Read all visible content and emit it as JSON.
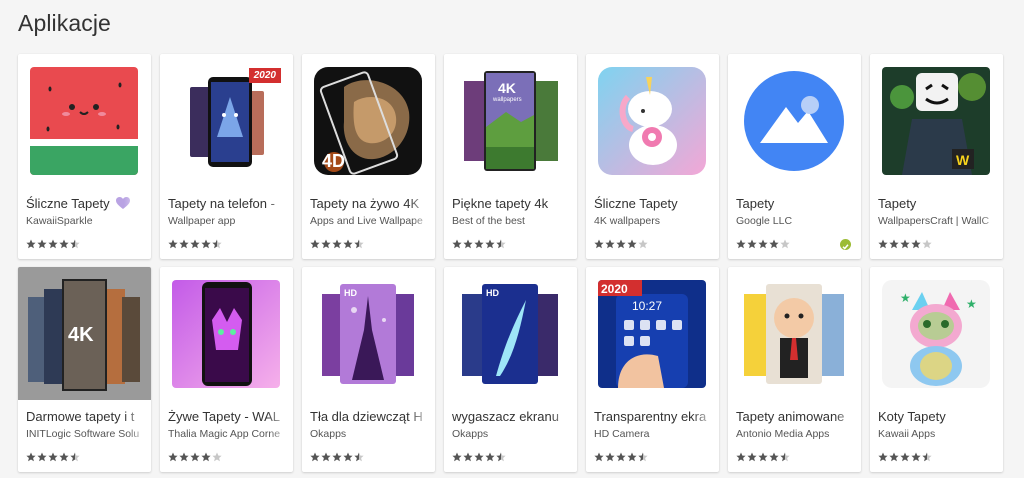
{
  "section": {
    "title": "Aplikacje"
  },
  "row1": [
    {
      "title": "Śliczne Tapety",
      "developer": "KawaiiSparkle",
      "rating": 4.5,
      "icon": "watermelon-icon",
      "heart": true
    },
    {
      "title": "Tapety na telefon - ",
      "developer": "Wallpaper app",
      "rating": 4.5,
      "icon": "wolf-phones-icon",
      "ribbon": "2020"
    },
    {
      "title": "Tapety na żywo 4K",
      "developer": "Apps and Live Wallpape",
      "rating": 4.5,
      "icon": "lion-4d-icon",
      "tag": "4D"
    },
    {
      "title": "Piękne tapety 4k",
      "developer": "Best of the best",
      "rating": 4.5,
      "icon": "landscape-phones-icon",
      "tag": "4K",
      "subtag": "wallpapers"
    },
    {
      "title": "Śliczne Tapety",
      "developer": "4K wallpapers",
      "rating": 4.0,
      "icon": "unicorn-icon"
    },
    {
      "title": "Tapety",
      "developer": "Google LLC",
      "rating": 4.0,
      "icon": "google-wallpapers-icon",
      "verified": true
    },
    {
      "title": "Tapety",
      "developer": "WallpapersCraft | WallC",
      "rating": 4.0,
      "icon": "marshmello-icon"
    }
  ],
  "row2": [
    {
      "title": "Darmowe tapety i t",
      "developer": "INITLogic Software Solu",
      "rating": 4.5,
      "icon": "4k-wallpapers-icon",
      "tag": "4K"
    },
    {
      "title": "Żywe Tapety - WAL",
      "developer": "Thalia Magic App Corne",
      "rating": 4.0,
      "icon": "neon-cat-phone-icon"
    },
    {
      "title": "Tła dla dziewcząt H",
      "developer": "Okapps",
      "rating": 4.5,
      "icon": "eiffel-tower-icon",
      "tag": "HD"
    },
    {
      "title": "wygaszacz ekranu",
      "developer": "Okapps",
      "rating": 4.5,
      "icon": "feather-phones-icon",
      "tag": "HD"
    },
    {
      "title": "Transparentny ekra",
      "developer": "HD Camera",
      "rating": 4.5,
      "icon": "transparent-screen-icon",
      "ribbon": "2020",
      "clock": "10:27"
    },
    {
      "title": "Tapety animowane",
      "developer": "Antonio Media Apps",
      "rating": 4.5,
      "icon": "boss-baby-icon"
    },
    {
      "title": "Koty Tapety",
      "developer": "Kawaii Apps",
      "rating": 4.5,
      "icon": "rainbow-kitten-icon"
    }
  ],
  "colors": {
    "star": "#555555",
    "star_empty": "#c7c7c7",
    "verified": "#9cbc34",
    "heart": "#b9a3e3"
  }
}
